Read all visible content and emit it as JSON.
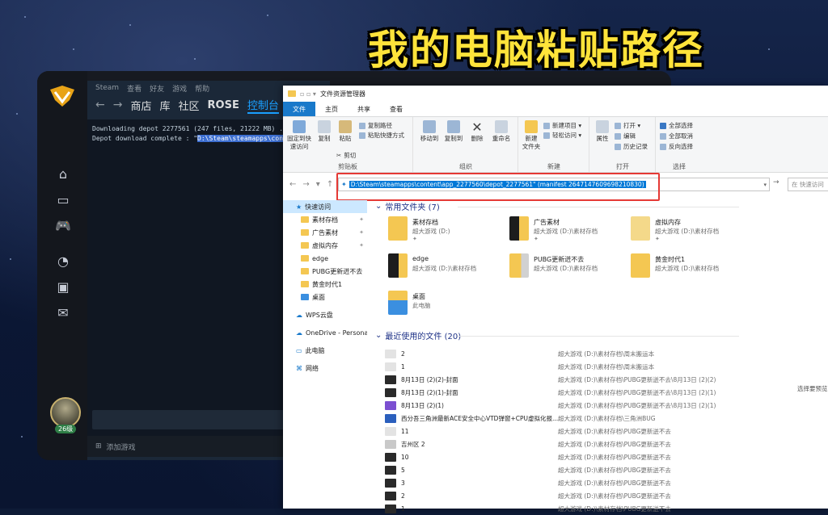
{
  "overlay": {
    "caption": "我的电脑粘贴路径"
  },
  "steam": {
    "titlebar": [
      "Steam",
      "查看",
      "好友",
      "游戏",
      "帮助"
    ],
    "nav": [
      "商店",
      "库",
      "社区",
      "ROSE",
      "控制台"
    ],
    "console_lines": [
      "Downloading depot 2277561 (247 files, 21222 MB) ...",
      "Depot download complete : \""
    ],
    "console_highlight": "D:\\Steam\\steamapps\\content\\",
    "add_game": "添加游戏",
    "level": "26级"
  },
  "explorer": {
    "title": "文件资源管理器",
    "tabs": [
      "文件",
      "主页",
      "共享",
      "查看"
    ],
    "ribbon": {
      "clipboard": {
        "pin": "固定到快\n速访问",
        "copy": "复制",
        "paste": "粘贴",
        "copy_path": "复制路径",
        "paste_shortcut": "粘贴快捷方式",
        "cut": "剪切",
        "label": "剪贴板"
      },
      "organize": {
        "move_to": "移动到",
        "copy_to": "复制到",
        "delete": "删除",
        "rename": "重命名",
        "label": "组织"
      },
      "new": {
        "new_folder": "新建\n文件夹",
        "new_item": "新建项目 ▾",
        "easy_access": "轻松访问 ▾",
        "label": "新建"
      },
      "open": {
        "properties": "属性",
        "open": "打开 ▾",
        "edit": "编辑",
        "history": "历史记录",
        "label": "打开"
      },
      "select": {
        "select_all": "全部选择",
        "select_none": "全部取消",
        "invert": "反向选择",
        "label": "选择"
      }
    },
    "address": "D:\\Steam\\steamapps\\content\\app_2277560\\depot_2277561\" (manifest 2647147609698210830)",
    "search_placeholder": "在 快速访问",
    "nav_pane": {
      "quick_access": "快速访问",
      "items": [
        "素材存档",
        "广告素材",
        "虚拟内存",
        "edge",
        "PUBG更新迸不去",
        "黄金时代1",
        "桌面"
      ],
      "wps": "WPS云盘",
      "onedrive": "OneDrive - Personal",
      "this_pc": "此电脑",
      "network": "网络"
    },
    "frequent": {
      "header": "常用文件夹 (7)",
      "items": [
        {
          "name": "素材存档",
          "sub": "超大游戏 (D:)"
        },
        {
          "name": "广告素材",
          "sub": "超大游戏 (D:)\\素材存档"
        },
        {
          "name": "虚拟内存",
          "sub": "超大游戏 (D:)\\素材存档"
        },
        {
          "name": "edge",
          "sub": "超大游戏 (D:)\\素材存档"
        },
        {
          "name": "PUBG更新迸不去",
          "sub": "超大游戏 (D:)\\素材存档"
        },
        {
          "name": "黄金时代1",
          "sub": "超大游戏 (D:)\\素材存档"
        },
        {
          "name": "桌面",
          "sub": "此电脑"
        }
      ]
    },
    "recent": {
      "header": "最近使用的文件 (20)",
      "rows": [
        {
          "name": "2",
          "loc": "超大游戏 (D:)\\素材存档\\周末搬运本"
        },
        {
          "name": "1",
          "loc": "超大游戏 (D:)\\素材存档\\周末搬运本"
        },
        {
          "name": "8月13日 (2)(2)-封面",
          "loc": "超大游戏 (D:)\\素材存档\\PUBG更新迸不去\\8月13日 (2)(2)"
        },
        {
          "name": "8月13日 (2)(1)-封面",
          "loc": "超大游戏 (D:)\\素材存档\\PUBG更新迸不去\\8月13日 (2)(1)"
        },
        {
          "name": "8月13日 (2)(1)",
          "loc": "超大游戏 (D:)\\素材存档\\PUBG更新迸不去\\8月13日 (2)(1)"
        },
        {
          "name": "西分吾三角洲最新ACE安全中心VTD弹窗+CPU虚拟化报...",
          "loc": "超大游戏 (D:)\\素材存档\\三角洲BUG"
        },
        {
          "name": "11",
          "loc": "超大游戏 (D:)\\素材存档\\PUBG更新迸不去"
        },
        {
          "name": "吉州区 2",
          "loc": "超大游戏 (D:)\\素材存档\\PUBG更新迸不去"
        },
        {
          "name": "10",
          "loc": "超大游戏 (D:)\\素材存档\\PUBG更新迸不去"
        },
        {
          "name": "5",
          "loc": "超大游戏 (D:)\\素材存档\\PUBG更新迸不去"
        },
        {
          "name": "3",
          "loc": "超大游戏 (D:)\\素材存档\\PUBG更新迸不去"
        },
        {
          "name": "2",
          "loc": "超大游戏 (D:)\\素材存档\\PUBG更新迸不去"
        },
        {
          "name": "1",
          "loc": "超大游戏 (D:)\\素材存档\\PUBG更新迸不去"
        }
      ],
      "preview_hint": "选择要预览"
    }
  }
}
